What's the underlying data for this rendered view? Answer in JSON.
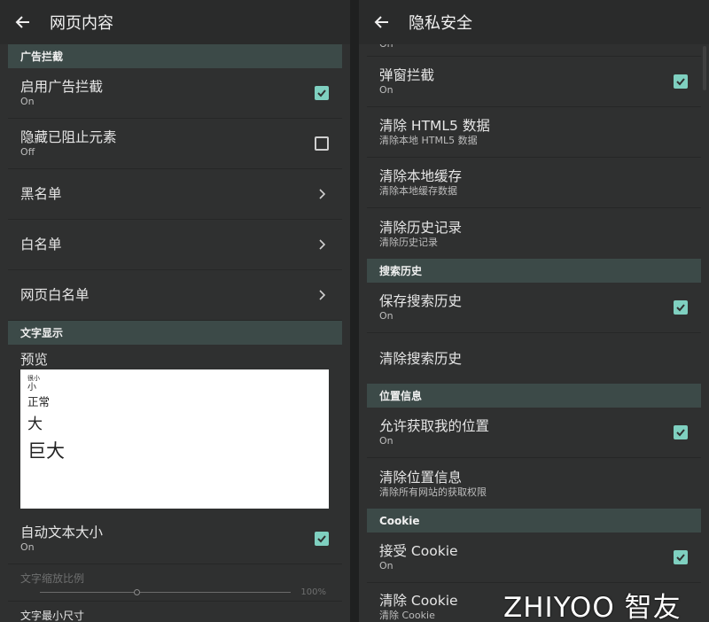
{
  "left": {
    "title": "网页内容",
    "sections": {
      "adblock": "广告拦截",
      "text": "文字显示"
    },
    "rows": {
      "enable_adblock": {
        "title": "启用广告拦截",
        "sub": "On"
      },
      "hide_blocked": {
        "title": "隐藏已阻止元素",
        "sub": "Off"
      },
      "blacklist": {
        "title": "黑名单"
      },
      "whitelist": {
        "title": "白名单"
      },
      "web_whitelist": {
        "title": "网页白名单"
      },
      "auto_text": {
        "title": "自动文本大小",
        "sub": "On"
      },
      "text_scale": {
        "title": "文字缩放比例",
        "value": "100%"
      },
      "min_size": {
        "title": "文字最小尺寸"
      }
    },
    "preview": {
      "label": "预览",
      "xs": "很小",
      "s": "小",
      "n": "正常",
      "l": "大",
      "xl": "巨大"
    }
  },
  "right": {
    "title": "隐私安全",
    "top_cut_sub": "On",
    "sections": {
      "search": "搜索历史",
      "location": "位置信息",
      "cookie": "Cookie"
    },
    "rows": {
      "popup": {
        "title": "弹窗拦截",
        "sub": "On"
      },
      "clear_html5": {
        "title": "清除 HTML5 数据",
        "sub": "清除本地 HTML5 数据"
      },
      "clear_cache": {
        "title": "清除本地缓存",
        "sub": "清除本地缓存数据"
      },
      "clear_history": {
        "title": "清除历史记录",
        "sub": "清除历史记录"
      },
      "save_search": {
        "title": "保存搜索历史",
        "sub": "On"
      },
      "clear_search": {
        "title": "清除搜索历史"
      },
      "allow_location": {
        "title": "允许获取我的位置",
        "sub": "On"
      },
      "clear_location": {
        "title": "清除位置信息",
        "sub": "清除所有网站的获取权限"
      },
      "accept_cookie": {
        "title": "接受 Cookie",
        "sub": "On"
      },
      "clear_cookie": {
        "title": "清除 Cookie",
        "sub": "清除 Cookie"
      }
    }
  },
  "watermark": "ZHIYOO 智友"
}
